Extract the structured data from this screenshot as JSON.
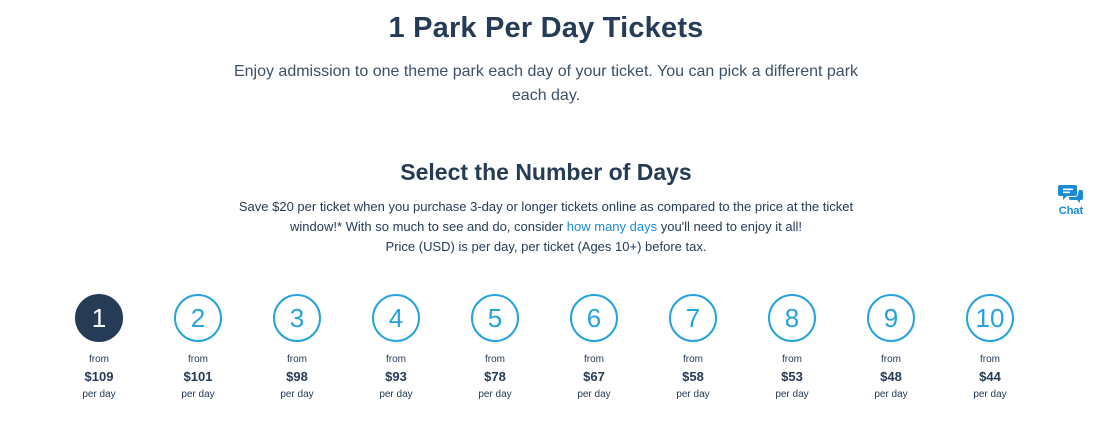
{
  "header": {
    "title": "1 Park Per Day Tickets",
    "subtitle": "Enjoy admission to one theme park each day of your ticket. You can pick a different park each day."
  },
  "section": {
    "title": "Select the Number of Days",
    "desc_before": "Save $20 per ticket when you purchase 3-day or longer tickets online as compared to the price at the ticket window!* With so much to see and do, consider ",
    "link_text": "how many days",
    "desc_after": " you'll need to enjoy it all!",
    "price_note": "Price (USD) is per day, per ticket (Ages 10+) before tax."
  },
  "days": [
    {
      "number": "1",
      "from": "from",
      "price": "$109",
      "per": "per day",
      "selected": true
    },
    {
      "number": "2",
      "from": "from",
      "price": "$101",
      "per": "per day",
      "selected": false
    },
    {
      "number": "3",
      "from": "from",
      "price": "$98",
      "per": "per day",
      "selected": false
    },
    {
      "number": "4",
      "from": "from",
      "price": "$93",
      "per": "per day",
      "selected": false
    },
    {
      "number": "5",
      "from": "from",
      "price": "$78",
      "per": "per day",
      "selected": false
    },
    {
      "number": "6",
      "from": "from",
      "price": "$67",
      "per": "per day",
      "selected": false
    },
    {
      "number": "7",
      "from": "from",
      "price": "$58",
      "per": "per day",
      "selected": false
    },
    {
      "number": "8",
      "from": "from",
      "price": "$53",
      "per": "per day",
      "selected": false
    },
    {
      "number": "9",
      "from": "from",
      "price": "$48",
      "per": "per day",
      "selected": false
    },
    {
      "number": "10",
      "from": "from",
      "price": "$44",
      "per": "per day",
      "selected": false
    }
  ],
  "chat": {
    "label": "Chat",
    "icon": "chat-bubbles-icon"
  },
  "colors": {
    "navy": "#253b56",
    "accent_blue": "#26a2de",
    "link_blue": "#1b8bd6"
  }
}
